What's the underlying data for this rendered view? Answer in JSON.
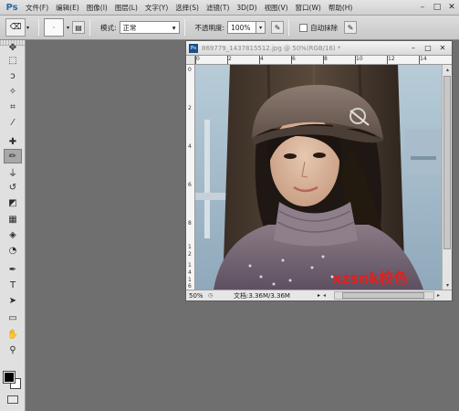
{
  "app": {
    "logo": "Ps"
  },
  "menu": [
    "文件(F)",
    "编辑(E)",
    "图像(I)",
    "图层(L)",
    "文字(Y)",
    "选择(S)",
    "滤镜(T)",
    "3D(D)",
    "视图(V)",
    "窗口(W)",
    "帮助(H)"
  ],
  "window_controls": {
    "minimize": "–",
    "restore": "□",
    "close": "✕"
  },
  "options": {
    "mode_label": "模式:",
    "mode_value": "正常",
    "opacity_label": "不透明度:",
    "opacity_value": "100%",
    "auto_erase_label": "自动抹除"
  },
  "document": {
    "title": "869779_1437815512.jpg @ 50%(RGB/16) *",
    "zoom": "50%",
    "doc_info": "文档:3.36M/3.36M",
    "ruler_h": [
      "0",
      "2",
      "4",
      "6",
      "8",
      "10",
      "12",
      "14"
    ],
    "ruler_v": [
      "0",
      "2",
      "4",
      "6",
      "8",
      "1",
      "2",
      "1",
      "4",
      "1",
      "6"
    ],
    "watermark": "xzsnk校色"
  },
  "colors": {
    "canvas_bg": "#6f6f6f",
    "watermark": "#e12020",
    "ps_blue": "#2a6aa8"
  },
  "tools": [
    "move-icon",
    "marquee-icon",
    "lasso-icon",
    "quick-select-icon",
    "crop-icon",
    "eyedropper-icon",
    "healing-brush-icon",
    "pencil-icon",
    "clone-stamp-icon",
    "history-brush-icon",
    "eraser-icon",
    "gradient-icon",
    "blur-icon",
    "dodge-icon",
    "pen-icon",
    "type-icon",
    "path-select-icon",
    "rectangle-icon",
    "hand-icon",
    "zoom-icon"
  ]
}
